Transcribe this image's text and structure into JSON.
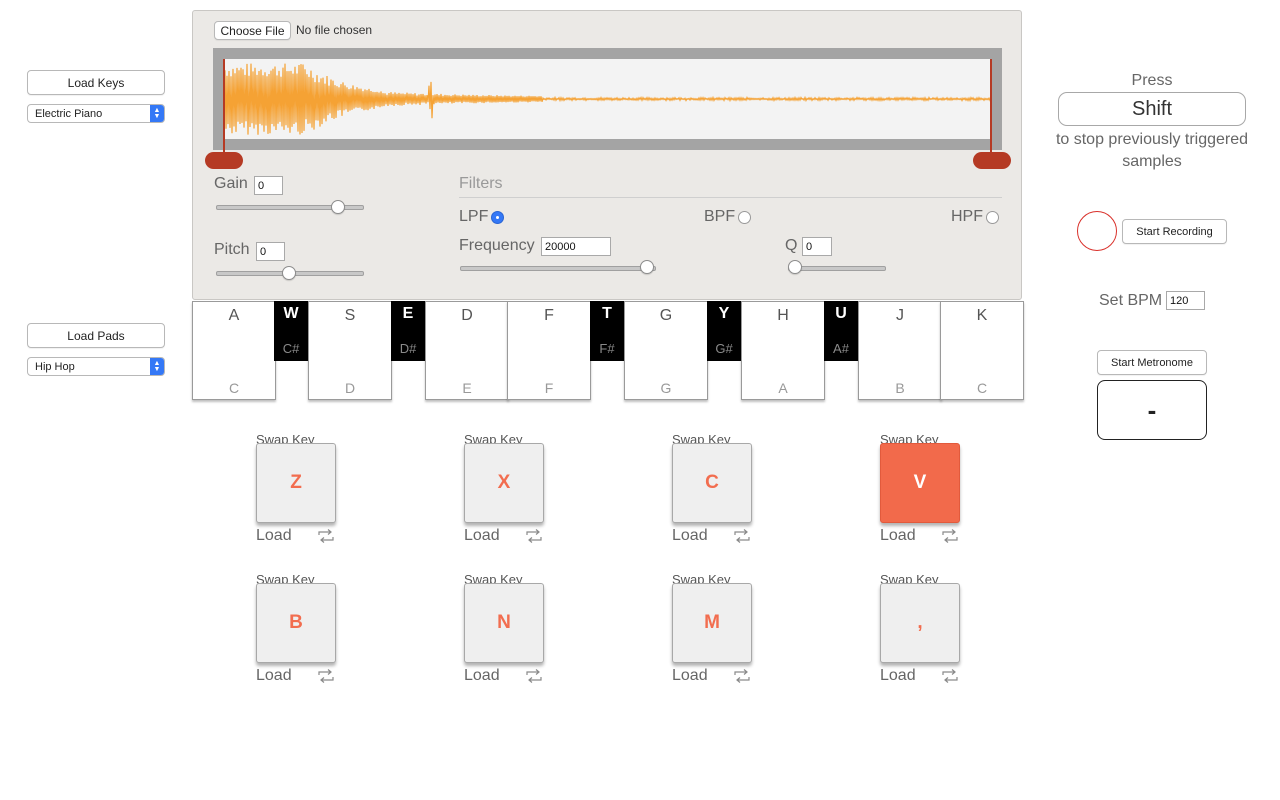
{
  "sidebar": {
    "load_keys_label": "Load Keys",
    "keys_instrument": "Electric Piano",
    "load_pads_label": "Load Pads",
    "pads_kit": "Hip Hop"
  },
  "sampler": {
    "file_button_label": "Choose File",
    "file_status": "No file chosen",
    "waveform_color": "#f5a234",
    "trim_handle_color": "#b53a24",
    "gain": {
      "label": "Gain",
      "value": "0",
      "slider_level": 0.87
    },
    "pitch": {
      "label": "Pitch",
      "value": "0",
      "slider_level": 0.5
    },
    "filters": {
      "title": "Filters",
      "options": [
        {
          "label": "LPF",
          "selected": true
        },
        {
          "label": "BPF",
          "selected": false
        },
        {
          "label": "HPF",
          "selected": false
        }
      ],
      "frequency": {
        "label": "Frequency",
        "value": "20000",
        "slider_level": 1.0
      },
      "q": {
        "label": "Q",
        "value": "0",
        "slider_level": 0.0
      }
    }
  },
  "keyboard": {
    "white_keys": [
      {
        "key": "A",
        "note": "C"
      },
      {
        "key": "S",
        "note": "D"
      },
      {
        "key": "D",
        "note": "E"
      },
      {
        "key": "F",
        "note": "F"
      },
      {
        "key": "G",
        "note": "G"
      },
      {
        "key": "H",
        "note": "A"
      },
      {
        "key": "J",
        "note": "B"
      },
      {
        "key": "K",
        "note": "C"
      }
    ],
    "black_keys": [
      {
        "key": "W",
        "note": "C#"
      },
      {
        "key": "E",
        "note": "D#"
      },
      {
        "key": "T",
        "note": "F#"
      },
      {
        "key": "Y",
        "note": "G#"
      },
      {
        "key": "U",
        "note": "A#"
      }
    ]
  },
  "pads": {
    "swap_label": "Swap Key",
    "load_label": "Load",
    "items": [
      {
        "key": "Z",
        "active": false
      },
      {
        "key": "X",
        "active": false
      },
      {
        "key": "C",
        "active": false
      },
      {
        "key": "V",
        "active": true
      },
      {
        "key": "B",
        "active": false
      },
      {
        "key": "N",
        "active": false
      },
      {
        "key": "M",
        "active": false
      },
      {
        "key": ",",
        "active": false
      }
    ],
    "accent_color": "#f26a4b"
  },
  "controls": {
    "press_label": "Press",
    "shift_key": "Shift",
    "stop_hint": "to stop previously triggered samples",
    "record_button_label": "Start Recording",
    "record_indicator_color": "#d9302a",
    "bpm_label": "Set BPM",
    "bpm_value": "120",
    "metronome_button_label": "Start Metronome",
    "metronome_display": "-"
  }
}
